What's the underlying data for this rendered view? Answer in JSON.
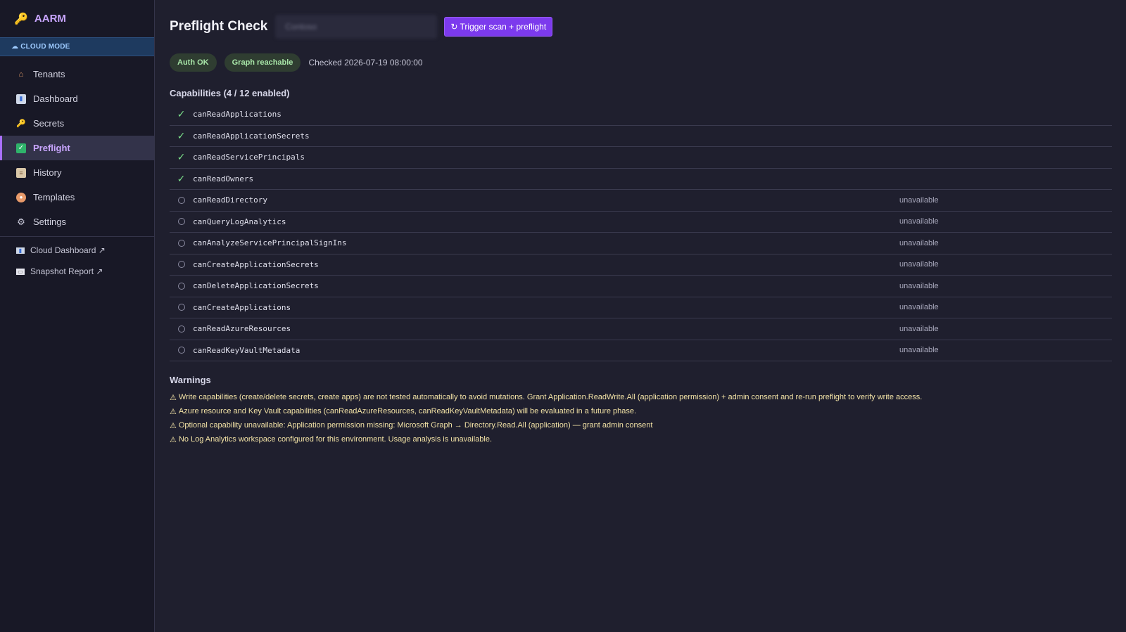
{
  "app": {
    "name": "AARM",
    "mode_label": "CLOUD MODE",
    "brand_icon": "key-icon",
    "mode_icon": "cloud-icon"
  },
  "sidebar": {
    "items": [
      {
        "label": "Tenants",
        "icon": "house-icon",
        "active": false
      },
      {
        "label": "Dashboard",
        "icon": "chart-icon",
        "active": false
      },
      {
        "label": "Secrets",
        "icon": "key-icon",
        "active": false
      },
      {
        "label": "Preflight",
        "icon": "checkbox-icon",
        "active": true
      },
      {
        "label": "History",
        "icon": "clipboard-icon",
        "active": false
      },
      {
        "label": "Templates",
        "icon": "palette-icon",
        "active": false
      },
      {
        "label": "Settings",
        "icon": "gear-icon",
        "active": false
      }
    ],
    "external_links": [
      {
        "label": "Cloud Dashboard ↗",
        "icon": "chart-icon"
      },
      {
        "label": "Snapshot Report ↗",
        "icon": "document-icon"
      }
    ]
  },
  "header": {
    "title": "Preflight Check",
    "tenant_select_value": "Contoso",
    "trigger_button": "↻ Trigger scan + preflight"
  },
  "status": {
    "badges": [
      "Auth OK",
      "Graph reachable"
    ],
    "checked": "Checked 2026-07-19 08:00:00"
  },
  "capabilities": {
    "title": "Capabilities (4 / 12 enabled)",
    "rows": [
      {
        "name": "canReadApplications",
        "enabled": true,
        "state": ""
      },
      {
        "name": "canReadApplicationSecrets",
        "enabled": true,
        "state": ""
      },
      {
        "name": "canReadServicePrincipals",
        "enabled": true,
        "state": ""
      },
      {
        "name": "canReadOwners",
        "enabled": true,
        "state": ""
      },
      {
        "name": "canReadDirectory",
        "enabled": false,
        "state": "unavailable"
      },
      {
        "name": "canQueryLogAnalytics",
        "enabled": false,
        "state": "unavailable"
      },
      {
        "name": "canAnalyzeServicePrincipalSignIns",
        "enabled": false,
        "state": "unavailable"
      },
      {
        "name": "canCreateApplicationSecrets",
        "enabled": false,
        "state": "unavailable"
      },
      {
        "name": "canDeleteApplicationSecrets",
        "enabled": false,
        "state": "unavailable"
      },
      {
        "name": "canCreateApplications",
        "enabled": false,
        "state": "unavailable"
      },
      {
        "name": "canReadAzureResources",
        "enabled": false,
        "state": "unavailable"
      },
      {
        "name": "canReadKeyVaultMetadata",
        "enabled": false,
        "state": "unavailable"
      }
    ]
  },
  "warnings": {
    "title": "Warnings",
    "items": [
      "Write capabilities (create/delete secrets, create apps) are not tested automatically to avoid mutations. Grant Application.ReadWrite.All (application permission) + admin consent and re-run preflight to verify write access.",
      "Azure resource and Key Vault capabilities (canReadAzureResources, canReadKeyVaultMetadata) will be evaluated in a future phase.",
      "Optional capability unavailable: Application permission missing: Microsoft Graph → Directory.Read.All (application) — grant admin consent",
      "No Log Analytics workspace configured for this environment. Usage analysis is unavailable."
    ]
  },
  "colors": {
    "accent": "#7c3aed",
    "active_nav": "#c9a6ff",
    "ok_badge": "#a8e6a8",
    "warning_text": "#f3e3a6"
  }
}
